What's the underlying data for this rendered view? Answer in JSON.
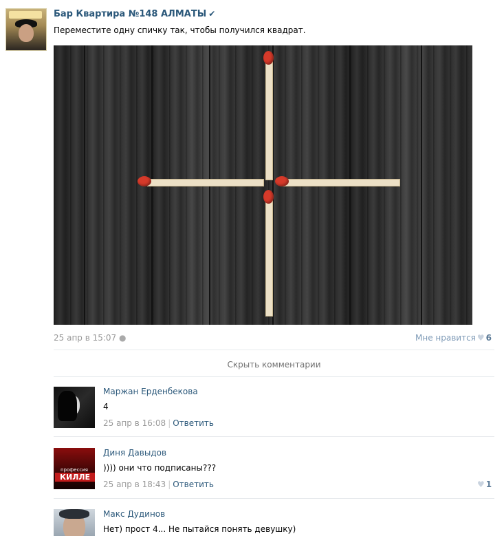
{
  "post": {
    "group_name": "Бар Квартира №148 АЛМАТЫ",
    "verified_icon": "checkmark-icon",
    "text": "Переместите одну спичку так, чтобы получился квадрат.",
    "timestamp": "25 апр в 15:07",
    "platform_icon": "apple-icon",
    "like_label": "Мне нравится",
    "like_icon": "heart-icon",
    "like_count": "6"
  },
  "hide_comments_label": "Скрыть комментарии",
  "comments": [
    {
      "author": "Маржан Ерденбекова",
      "text": "4",
      "time": "25 апр в 16:08",
      "reply": "Ответить",
      "likes": ""
    },
    {
      "author": "Диня Давыдов",
      "text": ")))) они что подписаны???",
      "time": "25 апр в 18:43",
      "reply": "Ответить",
      "likes": "1",
      "avatar_text_1": "профессия",
      "avatar_text_2": "КИЛЛЕ"
    },
    {
      "author": "Макс Дудинов",
      "text": "Нет) прост 4... Не пытайся понять девушку)"
    }
  ],
  "colors": {
    "link": "#2b587a",
    "muted": "#999999",
    "match_head": "#d63a2a"
  }
}
